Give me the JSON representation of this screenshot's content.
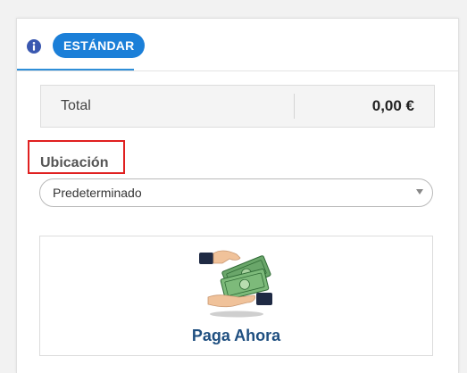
{
  "tab": {
    "label": "ESTÁNDAR",
    "icon": "info-icon"
  },
  "total": {
    "label": "Total",
    "value": "0,00 €"
  },
  "location": {
    "label": "Ubicación",
    "selected": "Predeterminado"
  },
  "payment": {
    "label": "Paga Ahora",
    "icon": "hands-money-icon"
  },
  "colors": {
    "accent": "#1b7fd8",
    "highlight": "#e02020",
    "pay_text": "#1f4f80"
  }
}
